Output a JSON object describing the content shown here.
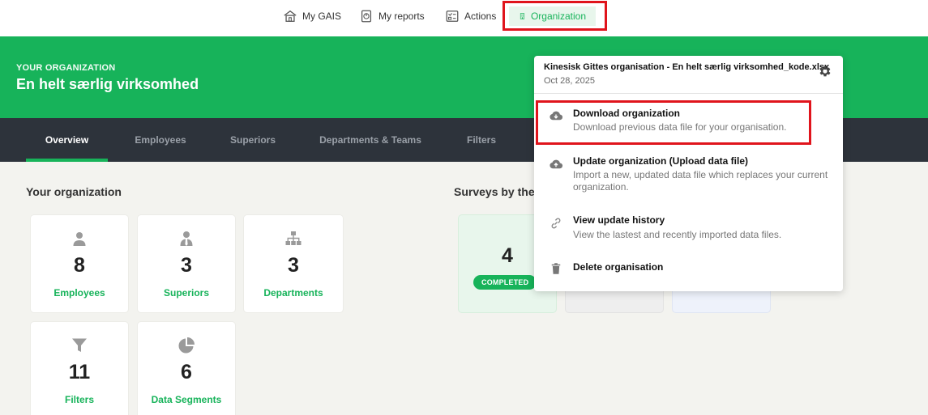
{
  "topnav": {
    "items": [
      {
        "label": "My GAIS",
        "icon": "home-icon"
      },
      {
        "label": "My reports",
        "icon": "reports-icon"
      },
      {
        "label": "Actions",
        "icon": "actions-icon"
      },
      {
        "label": "Organization",
        "icon": "building-icon",
        "active": true
      }
    ]
  },
  "banner": {
    "eyebrow": "YOUR ORGANIZATION",
    "org_name": "En helt særlig virksomhed"
  },
  "tabs": [
    "Overview",
    "Employees",
    "Superiors",
    "Departments & Teams",
    "Filters"
  ],
  "sections": {
    "your_org": "Your organization",
    "surveys": "Surveys by the"
  },
  "stats": [
    {
      "value": "8",
      "label": "Employees",
      "icon": "person-icon"
    },
    {
      "value": "3",
      "label": "Superiors",
      "icon": "superior-icon"
    },
    {
      "value": "3",
      "label": "Departments",
      "icon": "hierarchy-icon"
    },
    {
      "value": "11",
      "label": "Filters",
      "icon": "filter-icon"
    },
    {
      "value": "6",
      "label": "Data Segments",
      "icon": "pie-icon"
    }
  ],
  "surveys": {
    "completed_count": "4",
    "completed_label": "COMPLETED"
  },
  "menu": {
    "file_name": "Kinesisk Gittes organisation - En helt særlig virksomhed_kode.xlsx",
    "file_date": "Oct 28, 2025",
    "options": [
      {
        "title": "Download organization",
        "desc": "Download previous data file for your organisation.",
        "icon": "cloud-download-icon"
      },
      {
        "title": "Update organization (Upload data file)",
        "desc": "Import a new, updated data file which replaces your current organization.",
        "icon": "cloud-upload-icon"
      },
      {
        "title": "View update history",
        "desc": "View the lastest and recently imported data files.",
        "icon": "link-icon"
      },
      {
        "title": "Delete organisation",
        "desc": "",
        "icon": "trash-icon"
      }
    ]
  },
  "colors": {
    "brand_green": "#17b35a",
    "tab_bar": "#2d333b",
    "highlight_red": "#e0141c"
  }
}
